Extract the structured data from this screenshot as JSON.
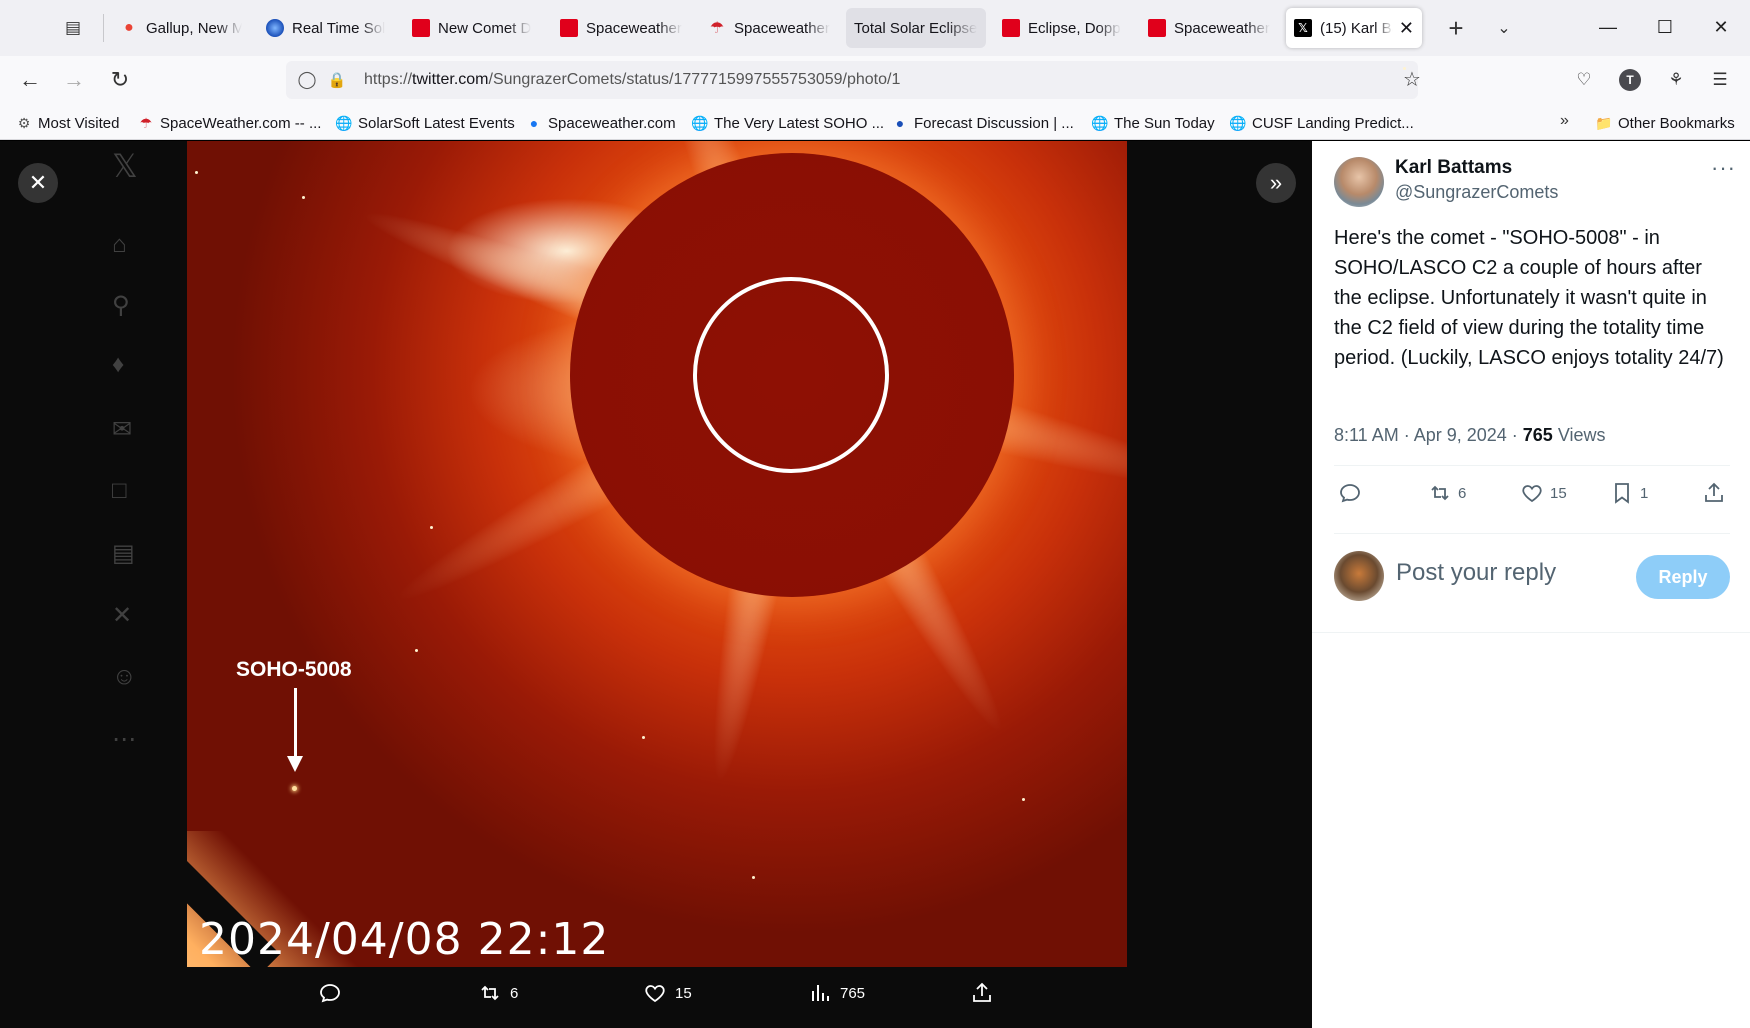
{
  "browser": {
    "tabs": [
      {
        "title": "Gallup, New M",
        "favicon": "maps-pin-icon"
      },
      {
        "title": "Real Time Sol",
        "favicon": "globe-blue-icon"
      },
      {
        "title": "New Comet D",
        "favicon": "red-square-icon"
      },
      {
        "title": "Spaceweather",
        "favicon": "red-square-icon"
      },
      {
        "title": "Spaceweather",
        "favicon": "umbrella-icon"
      },
      {
        "title": "Total Solar Eclipse",
        "favicon": "none"
      },
      {
        "title": "Eclipse, Dopp",
        "favicon": "red-square-icon"
      },
      {
        "title": "Spaceweather",
        "favicon": "red-square-icon"
      },
      {
        "title": "(15) Karl Ba",
        "favicon": "x-logo-icon"
      }
    ],
    "url_prefix": "https://",
    "url_domain": "twitter.com",
    "url_path": "/SungrazerComets/status/1777715997555753059/photo/1",
    "profile_initial": "T",
    "bookmarks": [
      "Most Visited",
      "SpaceWeather.com -- ...",
      "SolarSoft Latest Events",
      "Spaceweather.com",
      "The Very Latest SOHO ...",
      "Forecast Discussion | ...",
      "The Sun Today",
      "CUSF Landing Predict..."
    ],
    "other_bookmarks": "Other Bookmarks"
  },
  "media": {
    "comet_label": "SOHO-5008",
    "timestamp": "2024/04/08 22:12",
    "actions": {
      "replies": "",
      "reposts": "6",
      "likes": "15",
      "views": "765"
    }
  },
  "tweet": {
    "author_name": "Karl Battams",
    "author_handle": "@SungrazerComets",
    "text": "Here's the comet - \"SOHO-5008\" - in SOHO/LASCO C2 a couple of hours after the eclipse. Unfortunately it wasn't quite in the C2 field of view during the totality time period. (Luckily, LASCO enjoys totality 24/7)",
    "time": "8:11 AM · Apr 9, 2024 · ",
    "views_count": "765",
    "views_label": " Views",
    "reposts": "6",
    "likes": "15",
    "bookmarks": "1",
    "reply_placeholder": "Post your reply",
    "reply_button": "Reply"
  }
}
